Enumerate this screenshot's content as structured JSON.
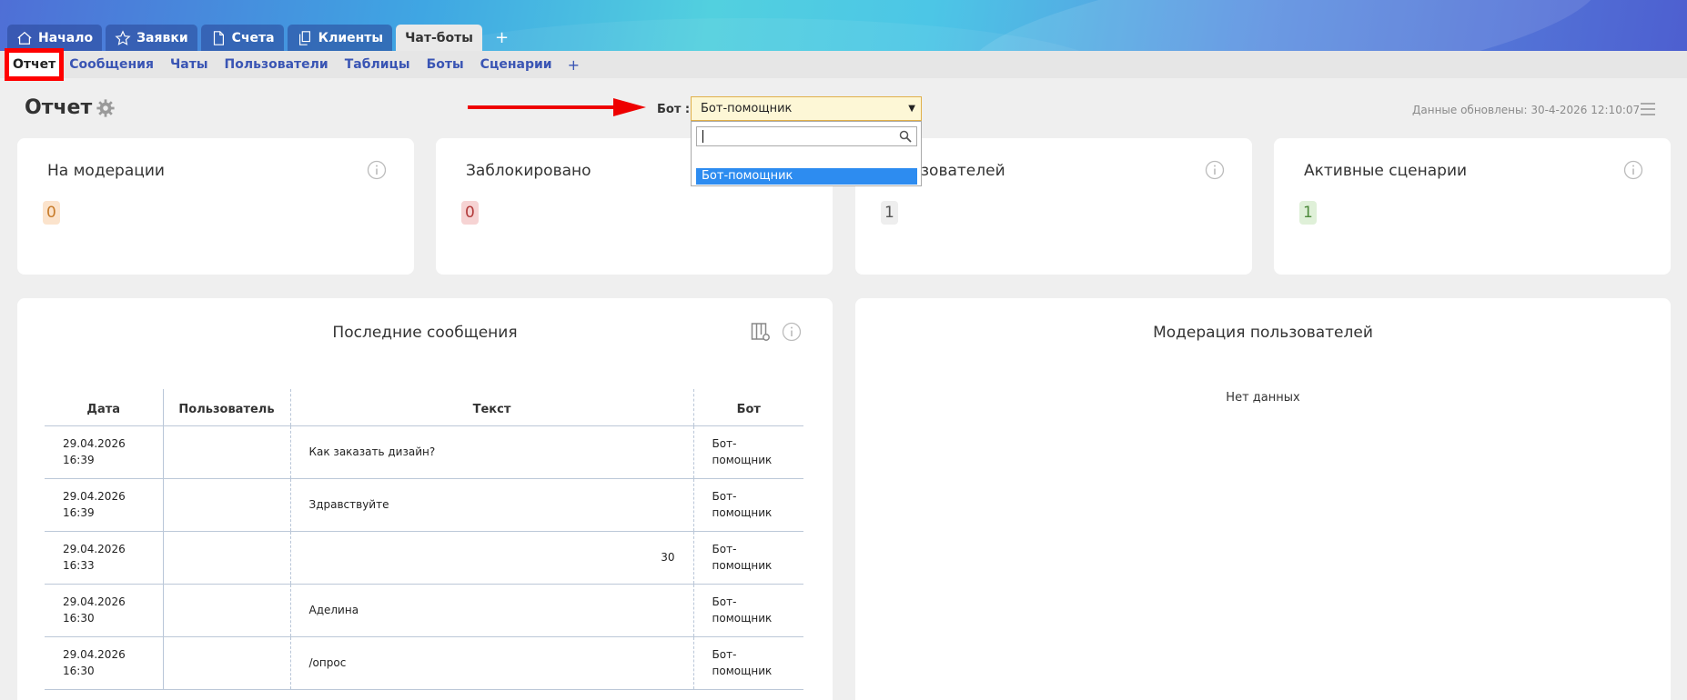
{
  "tabs": [
    {
      "label": "Начало",
      "icon": "home-icon"
    },
    {
      "label": "Заявки",
      "icon": "star-icon"
    },
    {
      "label": "Счета",
      "icon": "document-icon"
    },
    {
      "label": "Клиенты",
      "icon": "copy-icon"
    },
    {
      "label": "Чат-боты",
      "icon": ""
    }
  ],
  "tab_add": "+",
  "subnav": {
    "items": [
      "Отчет",
      "Сообщения",
      "Чаты",
      "Пользователи",
      "Таблицы",
      "Боты",
      "Сценарии"
    ],
    "add": "+"
  },
  "header": {
    "title": "Отчет",
    "bot_label": "Бот :",
    "bot_selected": "Бот-помощник",
    "dropdown_option": "Бот-помощник",
    "updated": "Данные обновлены: 30-4-2026 12:10:07"
  },
  "cards": [
    {
      "title": "На модерации",
      "value": "0",
      "color": "#fbe3cc"
    },
    {
      "title": "Заблокировано",
      "value": "0",
      "color": "#f6d3d3"
    },
    {
      "title": "зователей",
      "value": "1",
      "color": "#eeeeee"
    },
    {
      "title": "Активные сценарии",
      "value": "1",
      "color": "#dff0d8"
    }
  ],
  "messages_panel": {
    "title": "Последние сообщения",
    "columns": [
      "Дата",
      "Пользователь",
      "Текст",
      "Бот"
    ],
    "rows": [
      {
        "date": "29.04.2026",
        "time": "16:39",
        "user": "",
        "text": "Как заказать дизайн?",
        "bot1": "Бот-",
        "bot2": "помощник"
      },
      {
        "date": "29.04.2026",
        "time": "16:39",
        "user": "",
        "text": "Здравствуйте",
        "bot1": "Бот-",
        "bot2": "помощник"
      },
      {
        "date": "29.04.2026",
        "time": "16:33",
        "user": "",
        "text": "30",
        "bot1": "Бот-",
        "bot2": "помощник"
      },
      {
        "date": "29.04.2026",
        "time": "16:30",
        "user": "",
        "text": "Аделина",
        "bot1": "Бот-",
        "bot2": "помощник"
      },
      {
        "date": "29.04.2026",
        "time": "16:30",
        "user": "",
        "text": "/опрос",
        "bot1": "Бот-",
        "bot2": "помощник"
      }
    ]
  },
  "moderation_panel": {
    "title": "Модерация пользователей",
    "empty": "Нет данных"
  },
  "colors": {
    "accent": "#3a55b4",
    "highlight": "#ff0000",
    "selected_option": "#2d8cf0"
  }
}
